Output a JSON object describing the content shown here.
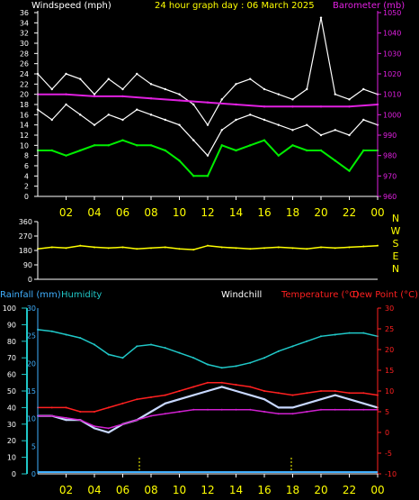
{
  "colors": {
    "background": "#000000",
    "axis_white": "#ffffff",
    "wind_speed": "#ffffff",
    "wind_gust": "#ffffff",
    "wind_avg": "#00ee00",
    "barometer": "#e020e0",
    "direction": "#ffff00",
    "humidity": "#20c8c8",
    "temperature": "#ff2020",
    "dewpoint": "#d020d0",
    "windchill": "#c8d8ff",
    "rainfall": "#40b0ff",
    "title": "#ffff00"
  },
  "chart_data": [
    {
      "type": "line",
      "title": "24 hour graph day : 06 March 2025",
      "left_label": "Windspeed (mph)",
      "right_label": "Barometer (mb)",
      "x_ticks": [
        "02",
        "04",
        "06",
        "08",
        "10",
        "12",
        "14",
        "16",
        "18",
        "20",
        "22",
        "00"
      ],
      "y_left_ticks": [
        "0",
        "2",
        "4",
        "6",
        "8",
        "10",
        "12",
        "14",
        "16",
        "18",
        "20",
        "22",
        "24",
        "26",
        "28",
        "30",
        "32",
        "34",
        "36"
      ],
      "y_right_ticks": [
        "960",
        "970",
        "980",
        "990",
        "1000",
        "1010",
        "1020",
        "1030",
        "1040",
        "1050"
      ],
      "ylim_left": [
        0,
        36
      ],
      "ylim_right": [
        960,
        1050
      ],
      "series": [
        {
          "key": "wind_speed",
          "x": [
            0,
            1,
            2,
            3,
            4,
            5,
            6,
            7,
            8,
            9,
            10,
            11,
            12,
            13,
            14,
            15,
            16,
            17,
            18,
            19,
            20,
            21,
            22,
            23,
            24
          ],
          "values": [
            17,
            15,
            18,
            16,
            14,
            16,
            15,
            17,
            16,
            15,
            14,
            11,
            8,
            13,
            15,
            16,
            15,
            14,
            13,
            14,
            12,
            13,
            12,
            15,
            14
          ]
        },
        {
          "key": "wind_gust",
          "x": [
            0,
            1,
            2,
            3,
            4,
            5,
            6,
            7,
            8,
            9,
            10,
            11,
            12,
            13,
            14,
            15,
            16,
            17,
            18,
            19,
            20,
            21,
            22,
            23,
            24
          ],
          "values": [
            24,
            21,
            24,
            23,
            20,
            23,
            21,
            24,
            22,
            21,
            20,
            18,
            14,
            19,
            22,
            23,
            21,
            20,
            19,
            21,
            35,
            20,
            19,
            21,
            20
          ]
        },
        {
          "key": "wind_avg",
          "x": [
            0,
            1,
            2,
            3,
            4,
            5,
            6,
            7,
            8,
            9,
            10,
            11,
            12,
            13,
            14,
            15,
            16,
            17,
            18,
            19,
            20,
            21,
            22,
            23,
            24
          ],
          "values": [
            9,
            9,
            8,
            9,
            10,
            10,
            11,
            10,
            10,
            9,
            7,
            4,
            4,
            10,
            9,
            10,
            11,
            8,
            10,
            9,
            9,
            7,
            5,
            9,
            9
          ]
        },
        {
          "key": "barometer",
          "x": [
            0,
            2,
            4,
            6,
            8,
            10,
            12,
            14,
            16,
            18,
            20,
            22,
            24
          ],
          "values": [
            1010,
            1010,
            1009,
            1009,
            1008,
            1007,
            1006,
            1005,
            1004,
            1004,
            1004,
            1004,
            1005
          ]
        }
      ]
    },
    {
      "type": "line",
      "title": "",
      "y_ticks": [
        "360",
        "270",
        "180",
        "90",
        "0"
      ],
      "right_labels": [
        "N",
        "W",
        "S",
        "E",
        "N"
      ],
      "ylim": [
        0,
        360
      ],
      "series": [
        {
          "key": "direction",
          "x": [
            0,
            1,
            2,
            3,
            4,
            5,
            6,
            7,
            8,
            9,
            10,
            11,
            12,
            13,
            14,
            15,
            16,
            17,
            18,
            19,
            20,
            21,
            22,
            23,
            24
          ],
          "values": [
            190,
            200,
            195,
            210,
            200,
            195,
            200,
            190,
            195,
            200,
            190,
            185,
            210,
            200,
            195,
            190,
            195,
            200,
            195,
            190,
            200,
            195,
            200,
            205,
            210
          ]
        }
      ]
    },
    {
      "type": "line",
      "title": "",
      "labels": {
        "rainfall": "Rainfall (mm)",
        "humidity": "Humidity",
        "windchill": "Windchill",
        "temperature": "Temperature (°C)",
        "dewpoint": "Dew Point (°C)"
      },
      "x_ticks": [
        "02",
        "04",
        "06",
        "08",
        "10",
        "12",
        "14",
        "16",
        "18",
        "20",
        "22",
        "00"
      ],
      "y_humidity_ticks": [
        "0",
        "10",
        "20",
        "30",
        "40",
        "50",
        "60",
        "70",
        "80",
        "90",
        "100"
      ],
      "y_rain_ticks": [
        "0",
        "5",
        "10",
        "15",
        "20",
        "25",
        "30"
      ],
      "y_temp_ticks": [
        "30",
        "25",
        "20",
        "15",
        "10",
        "5",
        "0",
        "-5",
        "-10"
      ],
      "ylim_humidity": [
        0,
        100
      ],
      "ylim_temp": [
        -10,
        30
      ],
      "series": [
        {
          "key": "humidity",
          "x": [
            0,
            1,
            2,
            3,
            4,
            5,
            6,
            7,
            8,
            9,
            10,
            11,
            12,
            13,
            14,
            15,
            16,
            17,
            18,
            19,
            20,
            21,
            22,
            23,
            24
          ],
          "values": [
            87,
            86,
            84,
            82,
            78,
            72,
            70,
            77,
            78,
            76,
            73,
            70,
            66,
            64,
            65,
            67,
            70,
            74,
            77,
            80,
            83,
            84,
            85,
            85,
            83
          ]
        },
        {
          "key": "temperature",
          "x": [
            0,
            1,
            2,
            3,
            4,
            5,
            6,
            7,
            8,
            9,
            10,
            11,
            12,
            13,
            14,
            15,
            16,
            17,
            18,
            19,
            20,
            21,
            22,
            23,
            24
          ],
          "values": [
            6,
            6,
            6,
            5,
            5,
            6,
            7,
            8,
            8.5,
            9,
            10,
            11,
            12,
            12,
            11.5,
            11,
            10,
            9.5,
            9,
            9.5,
            10,
            10,
            9.5,
            9.5,
            9
          ]
        },
        {
          "key": "windchill",
          "x": [
            0,
            1,
            2,
            3,
            4,
            5,
            6,
            7,
            8,
            9,
            10,
            11,
            12,
            13,
            14,
            15,
            16,
            17,
            18,
            19,
            20,
            21,
            22,
            23,
            24
          ],
          "values": [
            4,
            4,
            3,
            3,
            1,
            0,
            2,
            3,
            5,
            7,
            8,
            9,
            10,
            11,
            10,
            9,
            8,
            6,
            6,
            7,
            8,
            9,
            8,
            7,
            6
          ]
        },
        {
          "key": "dewpoint",
          "x": [
            0,
            1,
            2,
            3,
            4,
            5,
            6,
            7,
            8,
            9,
            10,
            11,
            12,
            13,
            14,
            15,
            16,
            17,
            18,
            19,
            20,
            21,
            22,
            23,
            24
          ],
          "values": [
            4,
            4,
            3.5,
            3,
            1.5,
            1,
            2,
            3,
            4,
            4.5,
            5,
            5.5,
            5.5,
            5.5,
            5.5,
            5.5,
            5,
            4.5,
            4.5,
            5,
            5.5,
            5.5,
            5.5,
            5.5,
            5.5
          ]
        },
        {
          "key": "rainfall",
          "x": [
            0,
            24
          ],
          "values": [
            0,
            0
          ]
        }
      ]
    }
  ]
}
